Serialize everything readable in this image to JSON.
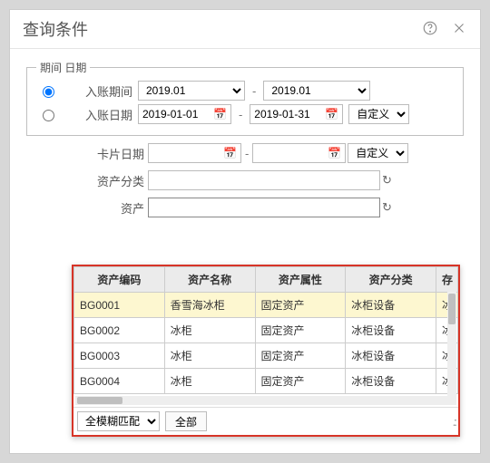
{
  "title": "查询条件",
  "period_box": {
    "legend": "期间 日期",
    "row1": {
      "label": "入账期间",
      "from": "2019.01",
      "to": "2019.01"
    },
    "row2": {
      "label": "入账日期",
      "from": "2019-01-01",
      "to": "2019-01-31",
      "preset": "自定义"
    }
  },
  "card_date": {
    "label": "卡片日期",
    "from": "",
    "to": "",
    "preset": "自定义"
  },
  "asset_class": {
    "label": "资产分类",
    "value": ""
  },
  "asset": {
    "label": "资产",
    "value": ""
  },
  "grid": {
    "headers": [
      "资产编码",
      "资产名称",
      "资产属性",
      "资产分类",
      "存"
    ],
    "rows": [
      {
        "code": "BG0001",
        "name": "香雪海冰柜",
        "attr": "固定资产",
        "cls": "冰柜设备",
        "ext": "冰"
      },
      {
        "code": "BG0002",
        "name": "冰柜",
        "attr": "固定资产",
        "cls": "冰柜设备",
        "ext": "冰"
      },
      {
        "code": "BG0003",
        "name": "冰柜",
        "attr": "固定资产",
        "cls": "冰柜设备",
        "ext": "冰"
      },
      {
        "code": "BG0004",
        "name": "冰柜",
        "attr": "固定资产",
        "cls": "冰柜设备",
        "ext": "冰"
      }
    ]
  },
  "popup_footer": {
    "match_mode": "全模糊匹配",
    "all_btn": "全部"
  }
}
